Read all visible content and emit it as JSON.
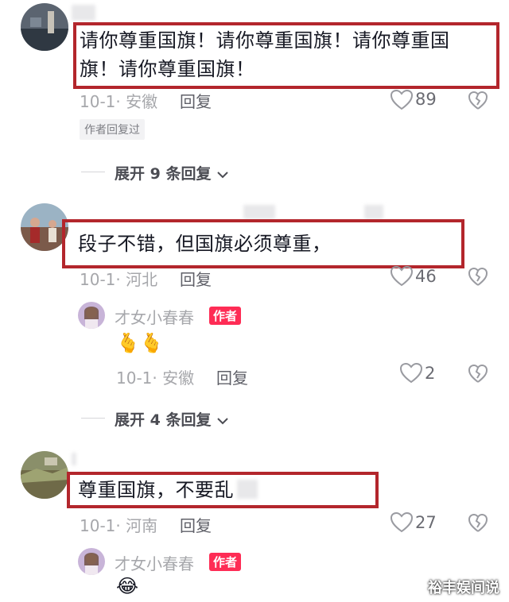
{
  "comments": [
    {
      "text": "请你尊重国旗！请你尊重国旗！请你尊重国旗！请你尊重国旗！",
      "text_line1": "请你尊重国旗！请你尊重国旗！请你尊重国",
      "text_line2": "旗！请你尊重国旗！",
      "meta": "10-1· 安徽",
      "reply_label": "回复",
      "likes": "89",
      "author_replied": "作者回复过",
      "expand_label": "展开 9 条回复"
    },
    {
      "text": "段子不错，但国旗必须尊重，",
      "meta": "10-1· 河北",
      "reply_label": "回复",
      "likes": "46",
      "reply": {
        "username": "才女小春春",
        "author_tag": "作者",
        "emoji": "🫰🫰",
        "meta": "10-1· 安徽",
        "reply_label": "回复",
        "likes": "2"
      },
      "expand_label": "展开 4 条回复"
    },
    {
      "text": "尊重国旗，不要乱",
      "meta": "10-1· 河南",
      "reply_label": "回复",
      "likes": "27",
      "reply": {
        "username": "才女小春春",
        "author_tag": "作者",
        "emoji": "😂"
      }
    }
  ],
  "watermark": "裕丰娱间说",
  "colors": {
    "highlight_box": "#b3262c",
    "author_tag": "#fe2c55",
    "meta_text": "#a6a7ab"
  }
}
